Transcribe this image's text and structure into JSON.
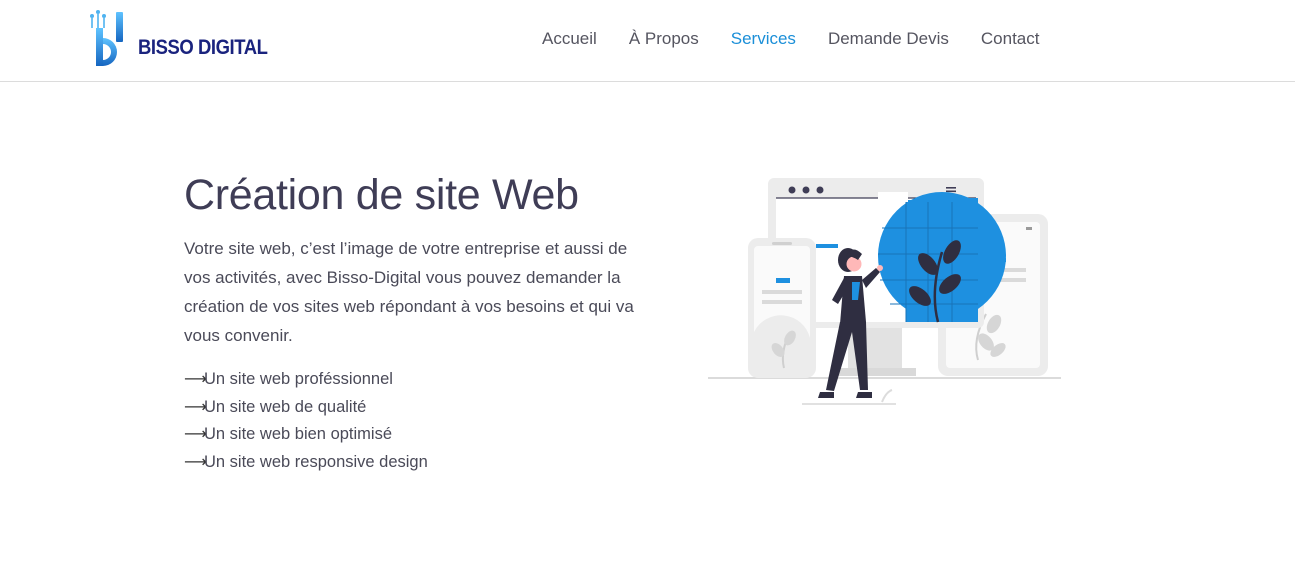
{
  "brand": {
    "name": "BISSO DIGITAL",
    "primary_color": "#1b8fd8",
    "dark_color": "#1a237e"
  },
  "nav": {
    "items": [
      {
        "label": "Accueil",
        "active": false
      },
      {
        "label": "À Propos",
        "active": false
      },
      {
        "label": "Services",
        "active": true
      },
      {
        "label": "Demande Devis",
        "active": false
      },
      {
        "label": "Contact",
        "active": false
      }
    ]
  },
  "hero": {
    "title": "Création de site Web",
    "description": "Votre site web, c’est l’image de votre entreprise et aussi de vos activités, avec Bisso-Digital vous pouvez demander la création de vos sites web répondant à vos besoins et qui va vous convenir.",
    "arrow_glyph": "⟶",
    "features": [
      "Un site web proféssionnel",
      "Un site web de qualité",
      "Un site web bien optimisé",
      "Un site web responsive design"
    ],
    "illustration_icon": "web-design-illustration",
    "illustration_accent": "#1e90e0"
  }
}
